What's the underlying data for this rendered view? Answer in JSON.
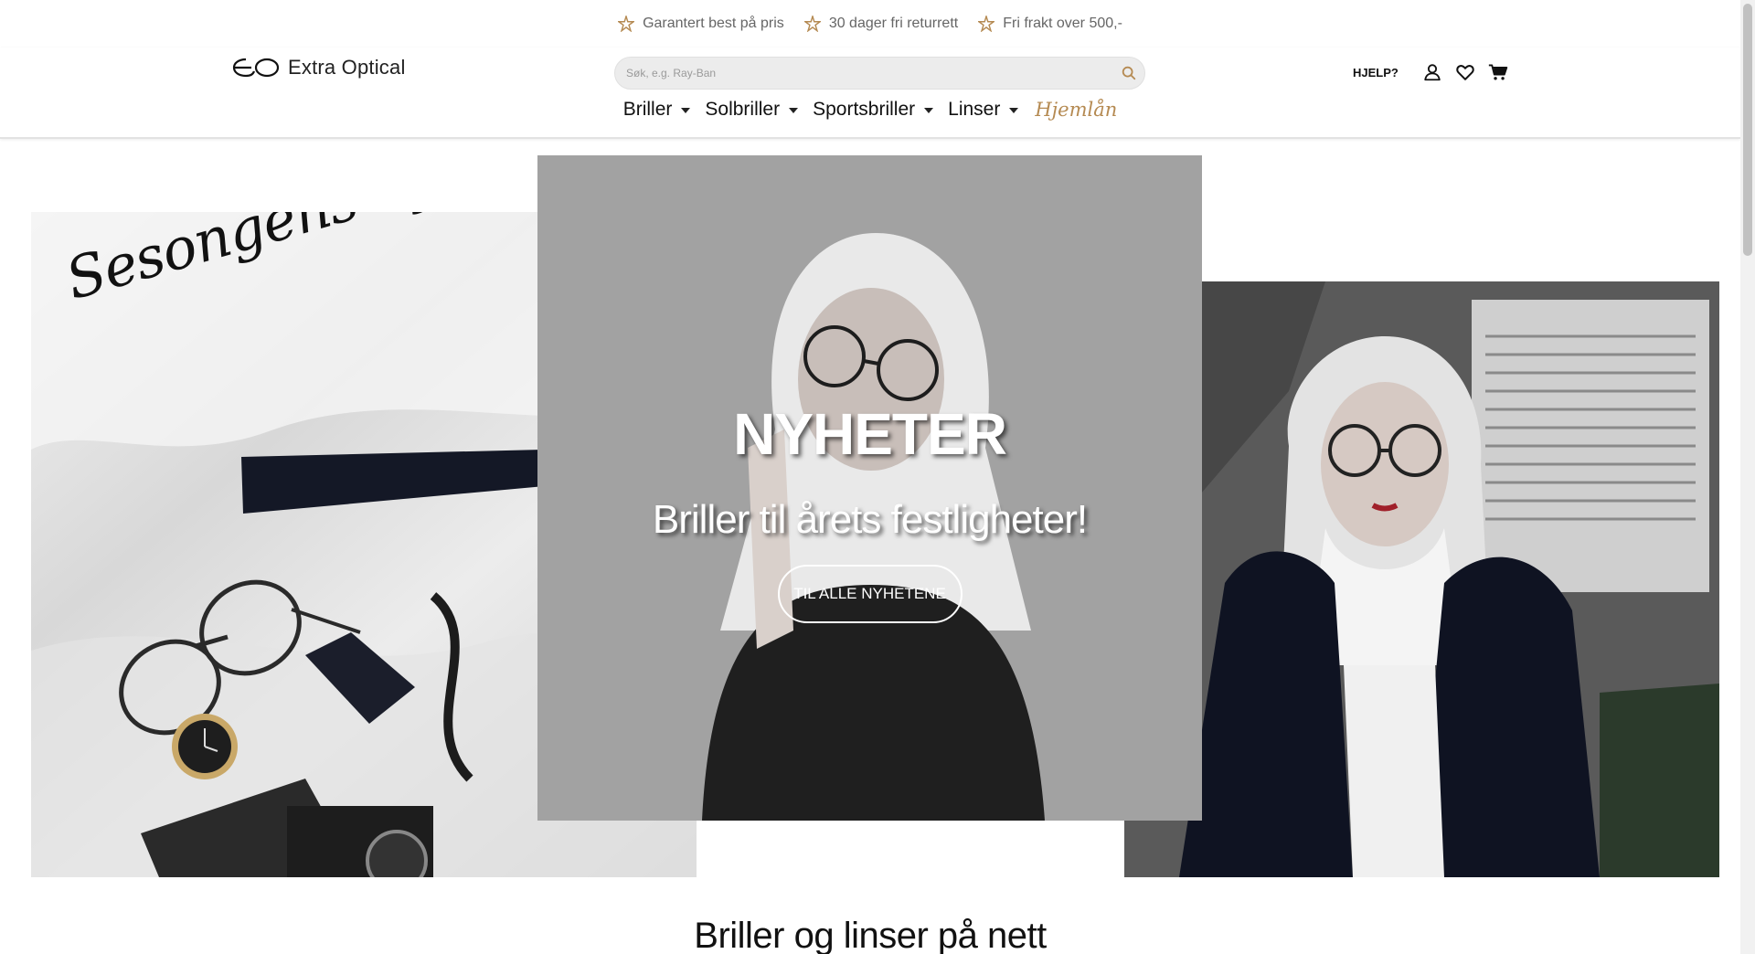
{
  "usp": [
    {
      "icon": "star-icon",
      "text": "Garantert best på pris"
    },
    {
      "icon": "star-icon",
      "text": "30 dager fri returrett"
    },
    {
      "icon": "star-icon",
      "text": "Fri frakt over 500,-"
    }
  ],
  "header": {
    "logo_text": "Extra Optical",
    "search_placeholder": "Søk, e.g. Ray-Ban",
    "help_label": "HJELP?"
  },
  "nav": [
    {
      "label": "Briller",
      "has_dropdown": true
    },
    {
      "label": "Solbriller",
      "has_dropdown": true
    },
    {
      "label": "Sportsbriller",
      "has_dropdown": true
    },
    {
      "label": "Linser",
      "has_dropdown": true
    },
    {
      "label": "Hjemlån",
      "has_dropdown": false
    }
  ],
  "hero": {
    "script_title": "Sesongens nyheter",
    "title": "NYHETER",
    "subtitle": "Briller til årets festligheter!",
    "button_label": "TIL ALLE NYHETENE"
  },
  "section_title": "Briller og linser på nett",
  "colors": {
    "accent": "#b58a52",
    "usp_text": "#666666",
    "search_bg": "#ececec"
  }
}
